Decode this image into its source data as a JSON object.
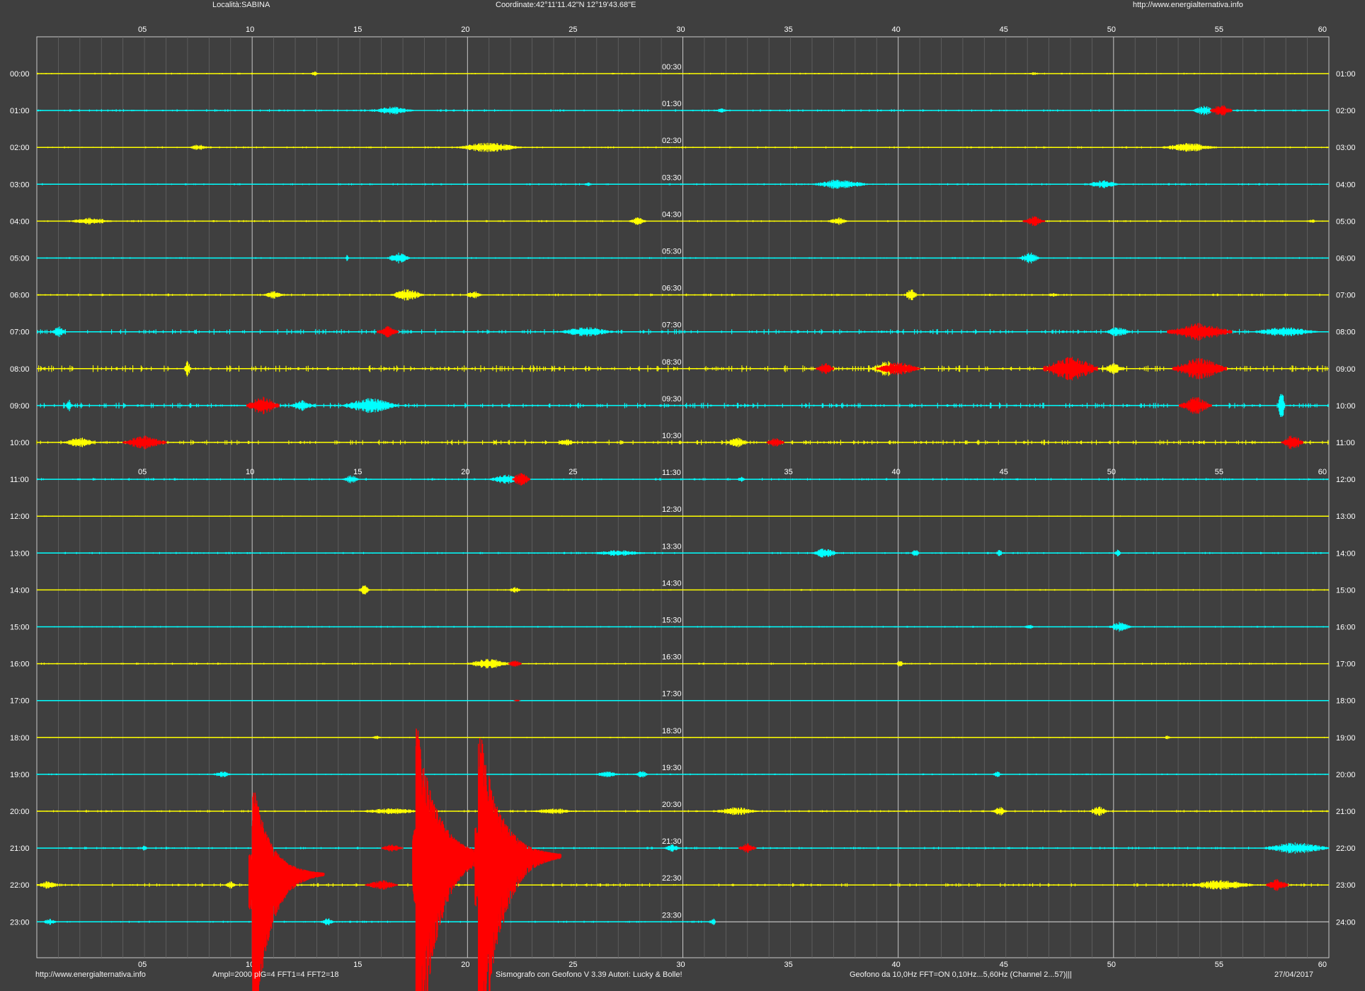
{
  "header": {
    "location": "Località:SABINA",
    "coordinates": "Coordinate:42°11'11.42\"N  12°19'43.68\"E",
    "url": "http://www.energialternativa.info"
  },
  "footer": {
    "url": "http://www.energialternativa.info",
    "amplification": "Ampl=2000    plG=4 FFT1=4 FFT2=18",
    "software": "Sismografo con Geofono V 3.39  Autori: Lucky & Bolle!",
    "filter": "Geofono da 10,0Hz FFT=ON 0,10Hz...5,60Hz      (Channel 2...57)|||",
    "date": "27/04/2017"
  },
  "colors": {
    "background": "#3f3f3f",
    "grid_major": "#c8c8c8",
    "grid_minor": "#646464",
    "trace_even": "#ffff00",
    "trace_odd": "#00ffff",
    "event": "#ff0000",
    "axis_text": "#ffffff"
  },
  "chart_data": {
    "type": "line",
    "title": "",
    "x_axis": {
      "unit": "minutes",
      "range": [
        0,
        60
      ],
      "top_ticks": [
        "05",
        "10",
        "15",
        "20",
        "25",
        "30",
        "35",
        "40",
        "45",
        "50",
        "55",
        "60"
      ],
      "mid_ticks": [
        "05",
        "10",
        "15",
        "20",
        "25",
        "35",
        "40",
        "45",
        "50",
        "55",
        "60"
      ],
      "bottom_ticks": [
        "05",
        "10",
        "15",
        "20",
        "25",
        "30",
        "35",
        "40",
        "45",
        "50",
        "55",
        "60"
      ]
    },
    "left_labels": [
      "00:00",
      "01:00",
      "02:00",
      "03:00",
      "04:00",
      "05:00",
      "06:00",
      "07:00",
      "08:00",
      "09:00",
      "10:00",
      "11:00",
      "12:00",
      "13:00",
      "14:00",
      "15:00",
      "16:00",
      "17:00",
      "18:00",
      "19:00",
      "20:00",
      "21:00",
      "22:00",
      "23:00"
    ],
    "right_labels": [
      "01:00",
      "02:00",
      "03:00",
      "04:00",
      "05:00",
      "06:00",
      "07:00",
      "08:00",
      "09:00",
      "10:00",
      "11:00",
      "12:00",
      "13:00",
      "14:00",
      "15:00",
      "16:00",
      "17:00",
      "18:00",
      "19:00",
      "20:00",
      "21:00",
      "22:00",
      "23:00",
      "24:00"
    ],
    "center_labels": [
      "00:30",
      "01:30",
      "02:30",
      "03:30",
      "04:30",
      "05:30",
      "06:30",
      "07:30",
      "08:30",
      "09:30",
      "10:30",
      "11:30",
      "12:30",
      "13:30",
      "14:30",
      "15:30",
      "16:30",
      "17:30",
      "18:30",
      "19:30",
      "20:30",
      "21:30",
      "22:30",
      "23:30"
    ],
    "current_hour": 23,
    "current_minute": 31.5,
    "series": [
      {
        "hour": 0,
        "noise": 0.4,
        "events": [
          {
            "t": 12.9,
            "a": 0.3,
            "d": 0.3,
            "c": "trace"
          },
          {
            "t": 46.3,
            "a": 0.15,
            "d": 0.6,
            "c": "trace"
          }
        ]
      },
      {
        "hour": 1,
        "noise": 0.6,
        "events": [
          {
            "t": 16.5,
            "a": 0.4,
            "d": 2.0,
            "c": "trace"
          },
          {
            "t": 31.8,
            "a": 0.2,
            "d": 0.8,
            "c": "trace"
          },
          {
            "t": 54.2,
            "a": 0.5,
            "d": 1.0,
            "c": "trace"
          },
          {
            "t": 55.0,
            "a": 0.6,
            "d": 1.0,
            "c": "red"
          }
        ]
      },
      {
        "hour": 2,
        "noise": 0.5,
        "events": [
          {
            "t": 7.5,
            "a": 0.3,
            "d": 1.0,
            "c": "trace"
          },
          {
            "t": 21.0,
            "a": 0.5,
            "d": 3.0,
            "c": "trace"
          },
          {
            "t": 53.5,
            "a": 0.45,
            "d": 2.5,
            "c": "trace"
          }
        ]
      },
      {
        "hour": 3,
        "noise": 0.5,
        "events": [
          {
            "t": 25.6,
            "a": 0.2,
            "d": 0.4,
            "c": "trace"
          },
          {
            "t": 37.3,
            "a": 0.5,
            "d": 2.5,
            "c": "trace"
          },
          {
            "t": 49.5,
            "a": 0.4,
            "d": 1.5,
            "c": "trace"
          }
        ]
      },
      {
        "hour": 4,
        "noise": 0.5,
        "events": [
          {
            "t": 2.5,
            "a": 0.35,
            "d": 2.0,
            "c": "trace"
          },
          {
            "t": 27.9,
            "a": 0.4,
            "d": 0.8,
            "c": "trace"
          },
          {
            "t": 37.2,
            "a": 0.4,
            "d": 0.9,
            "c": "trace"
          },
          {
            "t": 46.3,
            "a": 0.5,
            "d": 1.0,
            "c": "red"
          },
          {
            "t": 59.2,
            "a": 0.2,
            "d": 0.5,
            "c": "trace"
          }
        ]
      },
      {
        "hour": 5,
        "noise": 0.4,
        "events": [
          {
            "t": 14.4,
            "a": 0.3,
            "d": 0.2,
            "c": "trace"
          },
          {
            "t": 16.8,
            "a": 0.6,
            "d": 1.0,
            "c": "trace"
          },
          {
            "t": 46.1,
            "a": 0.6,
            "d": 0.9,
            "c": "trace"
          }
        ]
      },
      {
        "hour": 6,
        "noise": 0.6,
        "events": [
          {
            "t": 11.0,
            "a": 0.4,
            "d": 0.9,
            "c": "trace"
          },
          {
            "t": 17.2,
            "a": 0.6,
            "d": 1.5,
            "c": "trace"
          },
          {
            "t": 20.3,
            "a": 0.4,
            "d": 0.8,
            "c": "trace"
          },
          {
            "t": 40.6,
            "a": 0.6,
            "d": 0.6,
            "c": "trace"
          },
          {
            "t": 47.2,
            "a": 0.2,
            "d": 0.6,
            "c": "trace"
          }
        ]
      },
      {
        "hour": 7,
        "noise": 1.3,
        "events": [
          {
            "t": 1.0,
            "a": 0.6,
            "d": 0.6,
            "c": "trace"
          },
          {
            "t": 16.3,
            "a": 0.6,
            "d": 1.0,
            "c": "red"
          },
          {
            "t": 25.5,
            "a": 0.5,
            "d": 2.5,
            "c": "trace"
          },
          {
            "t": 50.2,
            "a": 0.5,
            "d": 1.2,
            "c": "trace"
          },
          {
            "t": 54.0,
            "a": 0.9,
            "d": 3.0,
            "c": "red"
          },
          {
            "t": 58.0,
            "a": 0.5,
            "d": 3.0,
            "c": "trace"
          }
        ]
      },
      {
        "hour": 8,
        "noise": 1.6,
        "events": [
          {
            "t": 7.0,
            "a": 0.9,
            "d": 0.3,
            "c": "trace"
          },
          {
            "t": 36.6,
            "a": 0.6,
            "d": 0.8,
            "c": "red"
          },
          {
            "t": 39.5,
            "a": 0.8,
            "d": 1.5,
            "c": "trace"
          },
          {
            "t": 40.0,
            "a": 0.7,
            "d": 2.0,
            "c": "red"
          },
          {
            "t": 48.0,
            "a": 1.3,
            "d": 2.5,
            "c": "red"
          },
          {
            "t": 50.0,
            "a": 0.6,
            "d": 1.0,
            "c": "trace"
          },
          {
            "t": 54.0,
            "a": 1.1,
            "d": 2.5,
            "c": "red"
          }
        ]
      },
      {
        "hour": 9,
        "noise": 1.4,
        "events": [
          {
            "t": 1.5,
            "a": 0.6,
            "d": 0.3,
            "c": "trace"
          },
          {
            "t": 10.5,
            "a": 0.9,
            "d": 1.5,
            "c": "red"
          },
          {
            "t": 12.3,
            "a": 0.6,
            "d": 1.0,
            "c": "trace"
          },
          {
            "t": 15.5,
            "a": 0.8,
            "d": 2.5,
            "c": "trace"
          },
          {
            "t": 53.8,
            "a": 0.9,
            "d": 1.5,
            "c": "red"
          },
          {
            "t": 57.8,
            "a": 2.0,
            "d": 0.3,
            "c": "trace"
          }
        ]
      },
      {
        "hour": 10,
        "noise": 1.2,
        "events": [
          {
            "t": 2.0,
            "a": 0.5,
            "d": 1.5,
            "c": "trace"
          },
          {
            "t": 5.0,
            "a": 0.7,
            "d": 2.0,
            "c": "red"
          },
          {
            "t": 24.6,
            "a": 0.4,
            "d": 0.8,
            "c": "trace"
          },
          {
            "t": 32.5,
            "a": 0.5,
            "d": 1.0,
            "c": "trace"
          },
          {
            "t": 34.3,
            "a": 0.5,
            "d": 0.8,
            "c": "red"
          },
          {
            "t": 58.3,
            "a": 0.8,
            "d": 1.0,
            "c": "red"
          }
        ]
      },
      {
        "hour": 11,
        "noise": 0.6,
        "events": [
          {
            "t": 14.6,
            "a": 0.4,
            "d": 0.8,
            "c": "trace"
          },
          {
            "t": 21.8,
            "a": 0.5,
            "d": 1.5,
            "c": "trace"
          },
          {
            "t": 22.5,
            "a": 0.8,
            "d": 0.8,
            "c": "red"
          },
          {
            "t": 32.7,
            "a": 0.3,
            "d": 0.4,
            "c": "trace"
          }
        ]
      },
      {
        "hour": 12,
        "noise": 0.3,
        "events": []
      },
      {
        "hour": 13,
        "noise": 0.5,
        "events": [
          {
            "t": 27.0,
            "a": 0.3,
            "d": 2.5,
            "c": "trace"
          },
          {
            "t": 36.6,
            "a": 0.5,
            "d": 1.2,
            "c": "trace"
          },
          {
            "t": 40.8,
            "a": 0.35,
            "d": 0.4,
            "c": "trace"
          },
          {
            "t": 44.7,
            "a": 0.4,
            "d": 0.3,
            "c": "trace"
          },
          {
            "t": 50.2,
            "a": 0.4,
            "d": 0.3,
            "c": "trace"
          }
        ]
      },
      {
        "hour": 14,
        "noise": 0.4,
        "events": [
          {
            "t": 15.2,
            "a": 0.5,
            "d": 0.5,
            "c": "trace"
          },
          {
            "t": 22.2,
            "a": 0.3,
            "d": 0.6,
            "c": "trace"
          }
        ]
      },
      {
        "hour": 15,
        "noise": 0.4,
        "events": [
          {
            "t": 46.1,
            "a": 0.3,
            "d": 0.4,
            "c": "trace"
          },
          {
            "t": 50.3,
            "a": 0.5,
            "d": 1.0,
            "c": "trace"
          }
        ]
      },
      {
        "hour": 16,
        "noise": 0.5,
        "events": [
          {
            "t": 21.0,
            "a": 0.5,
            "d": 2.0,
            "c": "trace"
          },
          {
            "t": 22.2,
            "a": 0.4,
            "d": 0.6,
            "c": "red"
          },
          {
            "t": 40.1,
            "a": 0.35,
            "d": 0.4,
            "c": "trace"
          }
        ]
      },
      {
        "hour": 17,
        "noise": 0.2,
        "events": [
          {
            "t": 22.3,
            "a": 0.1,
            "d": 0.3,
            "c": "red"
          }
        ]
      },
      {
        "hour": 18,
        "noise": 0.3,
        "events": [
          {
            "t": 15.8,
            "a": 0.2,
            "d": 0.5,
            "c": "trace"
          },
          {
            "t": 52.5,
            "a": 0.2,
            "d": 0.4,
            "c": "trace"
          }
        ]
      },
      {
        "hour": 19,
        "noise": 0.4,
        "events": [
          {
            "t": 8.6,
            "a": 0.35,
            "d": 0.8,
            "c": "trace"
          },
          {
            "t": 26.5,
            "a": 0.3,
            "d": 1.2,
            "c": "trace"
          },
          {
            "t": 28.1,
            "a": 0.5,
            "d": 0.5,
            "c": "trace"
          },
          {
            "t": 44.6,
            "a": 0.3,
            "d": 0.4,
            "c": "trace"
          }
        ]
      },
      {
        "hour": 20,
        "noise": 0.6,
        "events": [
          {
            "t": 16.5,
            "a": 0.3,
            "d": 3.0,
            "c": "trace"
          },
          {
            "t": 24.0,
            "a": 0.3,
            "d": 2.0,
            "c": "trace"
          },
          {
            "t": 32.5,
            "a": 0.4,
            "d": 2.0,
            "c": "trace"
          },
          {
            "t": 44.7,
            "a": 0.5,
            "d": 0.7,
            "c": "trace"
          },
          {
            "t": 49.3,
            "a": 0.5,
            "d": 0.8,
            "c": "trace"
          }
        ]
      },
      {
        "hour": 21,
        "noise": 0.6,
        "events": [
          {
            "t": 5.0,
            "a": 0.3,
            "d": 0.3,
            "c": "trace"
          },
          {
            "t": 16.5,
            "a": 0.4,
            "d": 1.0,
            "c": "red"
          },
          {
            "t": 19.4,
            "a": 0.4,
            "d": 1.5,
            "c": "trace"
          },
          {
            "t": 29.5,
            "a": 0.4,
            "d": 0.7,
            "c": "trace"
          },
          {
            "t": 33.0,
            "a": 0.5,
            "d": 0.8,
            "c": "red"
          },
          {
            "t": 58.5,
            "a": 0.6,
            "d": 3.0,
            "c": "trace"
          }
        ]
      },
      {
        "hour": 22,
        "noise": 0.9,
        "events": [
          {
            "t": 0.5,
            "a": 0.4,
            "d": 1.0,
            "c": "trace"
          },
          {
            "t": 16.0,
            "a": 0.5,
            "d": 1.5,
            "c": "red"
          },
          {
            "t": 9.0,
            "a": 0.4,
            "d": 0.5,
            "c": "trace"
          },
          {
            "t": 55.0,
            "a": 0.5,
            "d": 3.0,
            "c": "trace"
          },
          {
            "t": 57.6,
            "a": 0.6,
            "d": 1.0,
            "c": "red"
          }
        ]
      },
      {
        "hour": 23,
        "noise": 0.5,
        "events": [
          {
            "t": 0.6,
            "a": 0.35,
            "d": 0.6,
            "c": "trace"
          },
          {
            "t": 13.5,
            "a": 0.4,
            "d": 0.6,
            "c": "trace"
          },
          {
            "t": 31.4,
            "a": 0.35,
            "d": 0.4,
            "c": "trace"
          }
        ]
      }
    ],
    "earthquakes": [
      {
        "t": 10.0,
        "hour": 21.7,
        "peak": 9.8,
        "decay_min": 3.5
      },
      {
        "t": 17.6,
        "hour": 21.2,
        "peak": 14.0,
        "decay_min": 4.0
      },
      {
        "t": 20.5,
        "hour": 21.2,
        "peak": 14.0,
        "decay_min": 4.0
      }
    ]
  }
}
